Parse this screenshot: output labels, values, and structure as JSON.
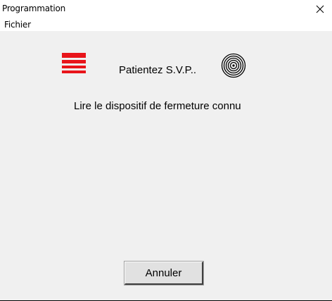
{
  "window": {
    "title": "Programmation",
    "close_symbol": "×"
  },
  "menu": {
    "items": [
      {
        "label": "Fichier"
      }
    ]
  },
  "status": {
    "wait_text": "Patientez S.V.P..",
    "instruction": "Lire le dispositif de fermeture connu"
  },
  "buttons": {
    "cancel_label": "Annuler"
  },
  "icons": {
    "logo": "red-stripes-logo-icon",
    "target": "concentric-circles-icon",
    "close": "close-icon"
  },
  "colors": {
    "logo_red": "#e8141a",
    "content_bg": "#f0f0f0",
    "titlebar_bg": "#ffffff"
  }
}
